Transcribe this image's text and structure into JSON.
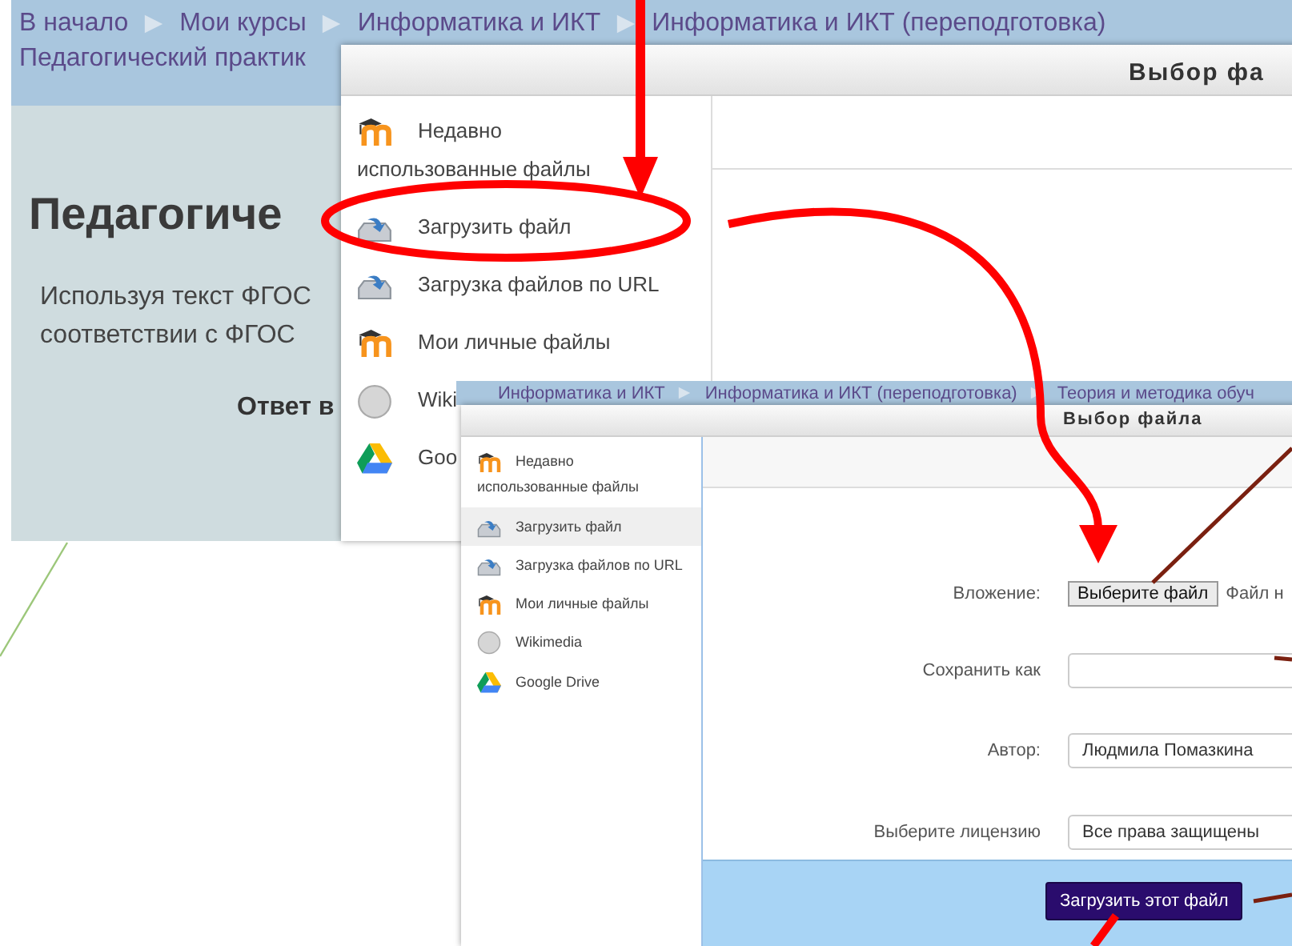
{
  "page": {
    "breadcrumbs": [
      {
        "label": "В начало"
      },
      {
        "label": "Мои курсы"
      },
      {
        "label": "Информатика и ИКТ"
      },
      {
        "label": "Информатика и ИКТ (переподготовка)"
      }
    ],
    "breadcrumb_line_2": "Педагогический практик",
    "heading": "Педагогиче",
    "text_lines": [
      "Используя текст ФГОС",
      "соответствии с ФГОС"
    ],
    "answer_label": "Ответ в"
  },
  "dialog_1": {
    "title": "Выбор фа",
    "sidebar_items": [
      {
        "kind": "moodle",
        "label": "Недавно использованные файлы",
        "selected": false
      },
      {
        "kind": "upload",
        "label": "Загрузить файл",
        "selected": false
      },
      {
        "kind": "upload",
        "label": "Загрузка файлов по URL",
        "selected": false
      },
      {
        "kind": "moodle",
        "label": "Мои личные файлы",
        "selected": false
      },
      {
        "kind": "wiki",
        "label": "Wiki",
        "selected": false
      },
      {
        "kind": "drive",
        "label": "Goo",
        "selected": false
      }
    ]
  },
  "screenshot_2": {
    "breadcrumbs": [
      {
        "label": "Информатика и ИКТ"
      },
      {
        "label": "Информатика и ИКТ (переподготовка)"
      },
      {
        "label": "Теория и методика обуч"
      }
    ]
  },
  "dialog_2": {
    "title": "Выбор файла",
    "sidebar_items": [
      {
        "kind": "moodle",
        "label": "Недавно использованные файлы",
        "selected": false
      },
      {
        "kind": "upload",
        "label": "Загрузить файл",
        "selected": true
      },
      {
        "kind": "upload",
        "label": "Загрузка файлов по URL",
        "selected": false
      },
      {
        "kind": "moodle",
        "label": "Мои личные файлы",
        "selected": false
      },
      {
        "kind": "wiki",
        "label": "Wikimedia",
        "selected": false
      },
      {
        "kind": "drive",
        "label": "Google Drive",
        "selected": false
      }
    ],
    "form": {
      "attachment_label": "Вложение:",
      "choose_button": "Выберите файл",
      "file_status": "Файл н",
      "save_as_label": "Сохранить как",
      "author_label": "Автор:",
      "author_value": "Людмила Помазкина",
      "license_label": "Выберите лицензию",
      "license_value": "Все права защищены"
    },
    "upload_button": "Загрузить этот файл"
  }
}
